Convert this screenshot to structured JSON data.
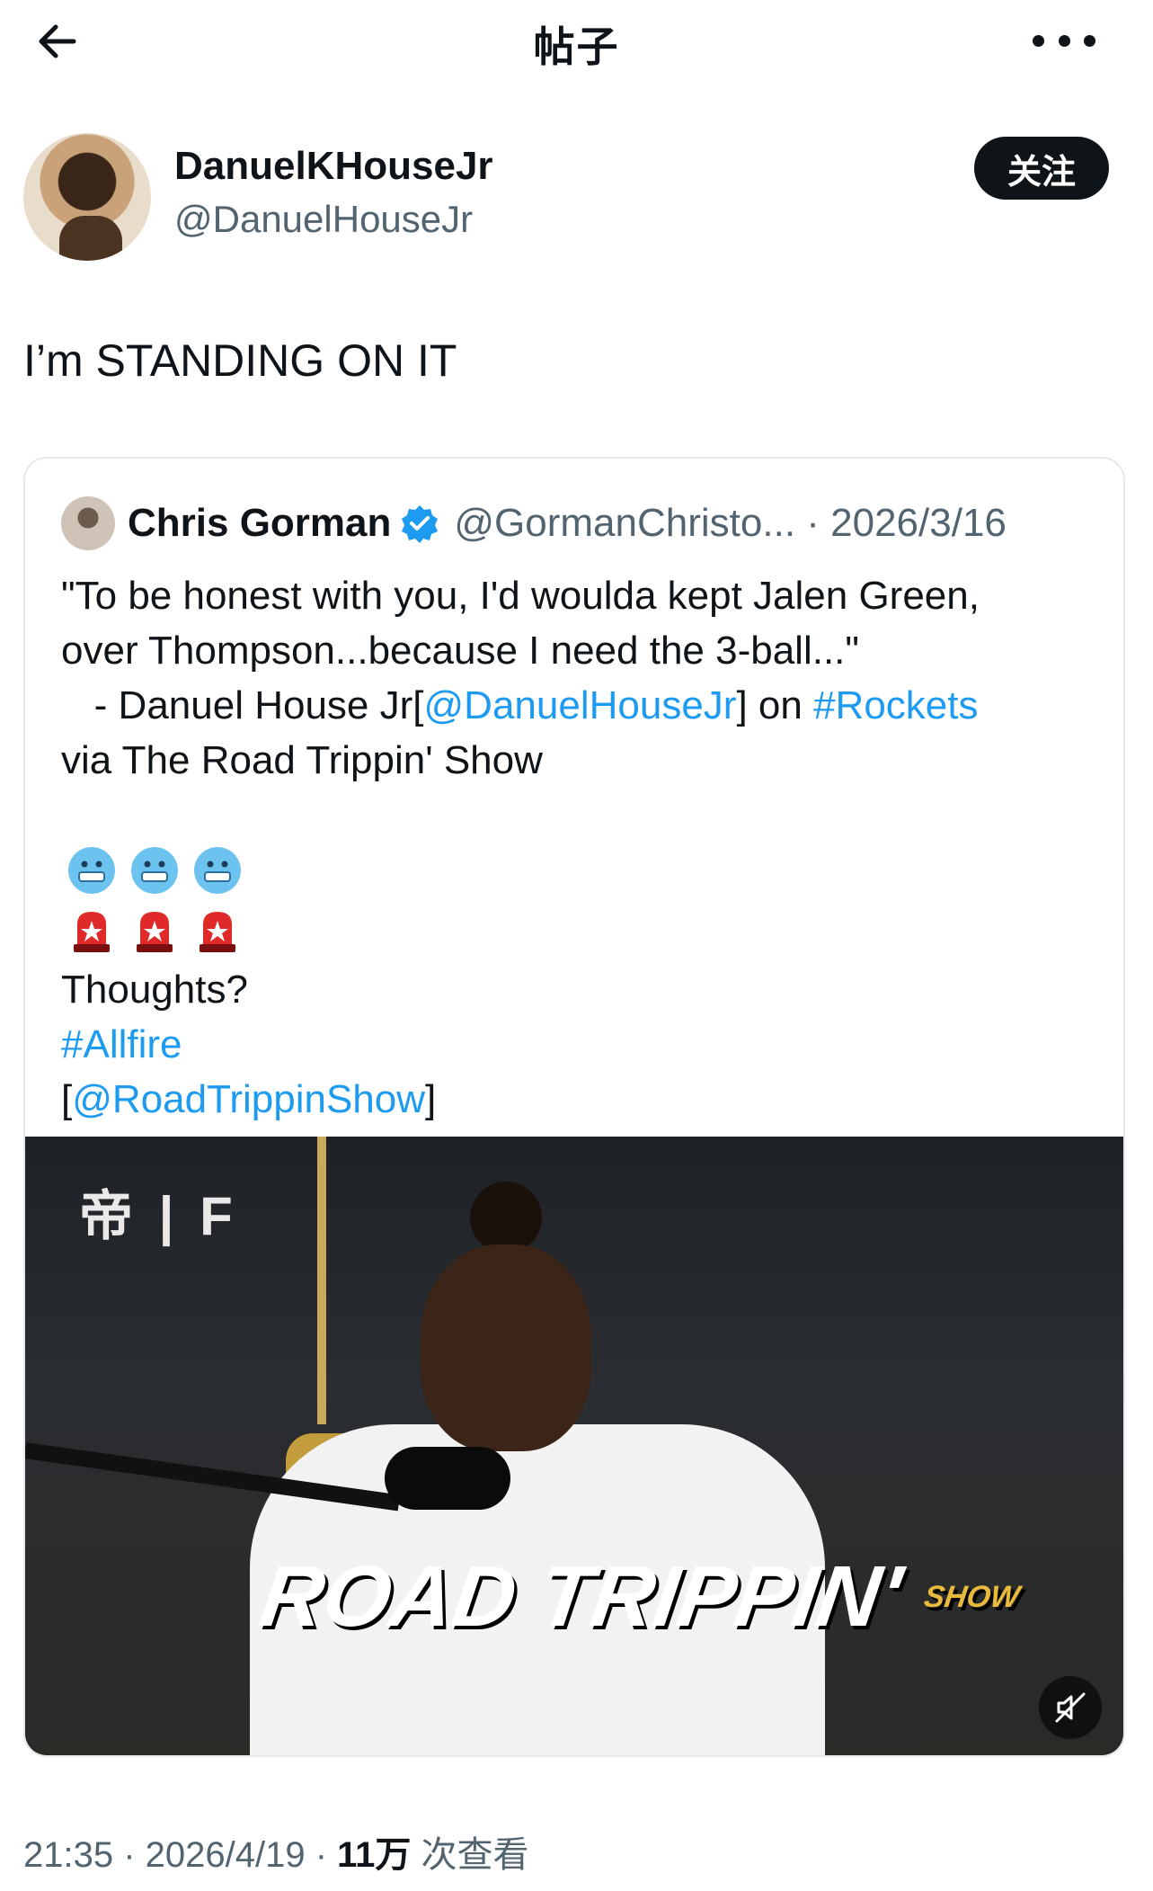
{
  "header": {
    "title": "帖子",
    "back_icon": "arrow-left-icon",
    "more_icon": "more-horizontal-icon"
  },
  "author": {
    "name": "DanuelKHouseJr",
    "handle": "@DanuelHouseJr",
    "follow_label": "关注"
  },
  "post": {
    "text": "I’m STANDING ON IT"
  },
  "quote": {
    "name": "Chris Gorman",
    "handle_date": "@GormanChristo... · 2026/3/16",
    "verified_color": "#1d9bf0",
    "line1": "\"To be honest with you, I'd woulda kept Jalen Green,",
    "line2": "over Thompson...because I need the 3-ball...\"",
    "line3_pre": "   - Danuel House Jr[",
    "line3_mention": "@DanuelHouseJr",
    "line3_mid": "] on ",
    "line3_hashtag": "#Rockets",
    "line4": "via The Road Trippin' Show",
    "emoji_top": [
      "🥶",
      "🥶",
      "🥶"
    ],
    "emoji_bottom": [
      "🚨",
      "🚨",
      "🚨"
    ],
    "thoughts": "Thoughts?",
    "hashtag2": "#Allfire",
    "mention2_open": "[",
    "mention2": "@RoadTrippinShow",
    "mention2_close": "]",
    "video": {
      "logo_text": "ROAD TRIPPIN'",
      "logo_show": "SHOW",
      "logo_left": "帝 | F",
      "mute_icon": "volume-muted-icon"
    }
  },
  "meta": {
    "time_date": "21:35 · 2026/4/19 · ",
    "views_count": "11万",
    "views_label": " 次查看"
  },
  "colors": {
    "link": "#1d9bf0",
    "text": "#0f1419",
    "secondary": "#536471"
  }
}
